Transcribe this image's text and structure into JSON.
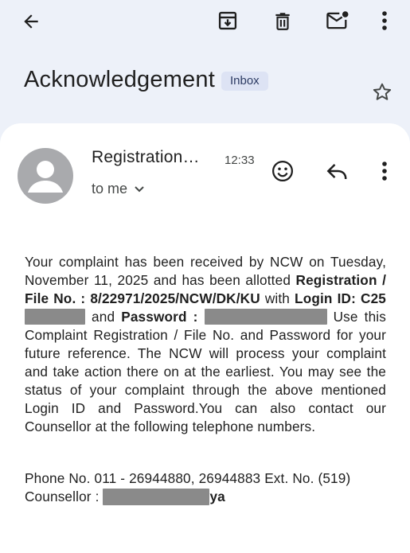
{
  "toolbar": {
    "back_icon": "arrow-back-icon",
    "archive_icon": "archive-icon",
    "delete_icon": "trash-icon",
    "mark_unread_icon": "mail-unread-icon",
    "more_icon": "more-vert-icon"
  },
  "email": {
    "subject": "Acknowledgement",
    "label": "Inbox",
    "sender": "Registration…",
    "time": "12:33",
    "recipient_line": "to me",
    "body": {
      "p1_a": "Your complaint has been received by NCW on Tuesday, November 11, 2025 and has been allotted ",
      "reg_label": "Registration / File No. : 8/22971/2025/NCW/DK/KU",
      "p1_b": " with ",
      "login_label": "Login ID: C25",
      "p1_c": " and ",
      "password_label": "Password :",
      "p1_d": " Use this Complaint Registration / File No. and Password for your future reference. The NCW will process your complaint and take action there on at the earliest. You may see the status of your complaint through the above mentioned Login ID and Password.You can also contact our Counsellor at the following telephone numbers.",
      "phone_line": "Phone No. 011 - 26944880, 26944883 Ext. No. (519)",
      "counsellor_label": "Counsellor : ",
      "counsellor_suffix": "ya"
    }
  },
  "colors": {
    "background": "#edf1f9",
    "card": "#ffffff",
    "badge_bg": "#dde3f4",
    "redaction": "#8a8a8a"
  }
}
